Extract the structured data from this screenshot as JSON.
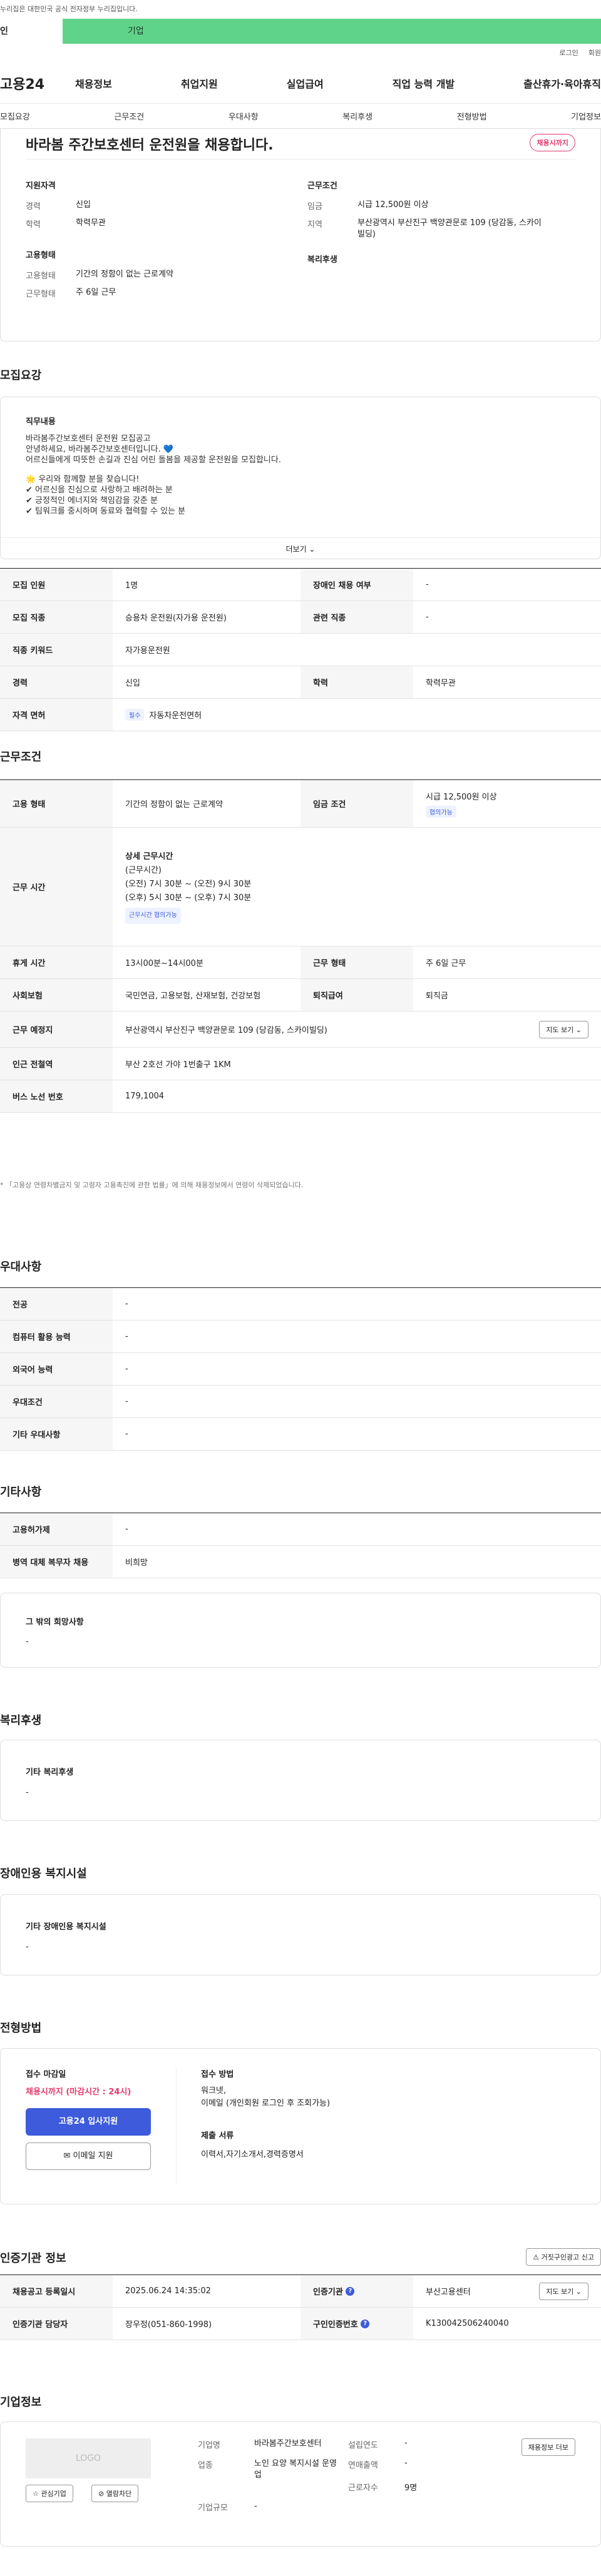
{
  "topbar": {
    "notice": "누리집은 대한민국 공식 전자정부 누리집입니다."
  },
  "tabs": {
    "person": "인",
    "business": "기업"
  },
  "utility": {
    "login": "로그인",
    "join": "회원"
  },
  "gnb": {
    "logo": "고용24",
    "menu": [
      "채용정보",
      "취업지원",
      "실업급여",
      "직업 능력 개발",
      "출산휴가·육아휴직"
    ]
  },
  "anchor": [
    "모집요강",
    "근무조건",
    "우대사항",
    "복리후생",
    "전형방법",
    "기업정보"
  ],
  "hero": {
    "title": "바라봄 주간보호센터 운전원을 채용합니다.",
    "status": "채용시까지",
    "qual_heading": "지원자격",
    "cond_heading": "근무조건",
    "emp_heading": "고용형태",
    "welfare_heading": "복리후생",
    "qual": [
      {
        "k": "경력",
        "v": "신입"
      },
      {
        "k": "학력",
        "v": "학력무관"
      }
    ],
    "cond": [
      {
        "k": "임금",
        "v": "시급 12,500원 이상"
      },
      {
        "k": "지역",
        "v": "부산광역시 부산진구 백양관문로 109 (당감동, 스카이빌딩)"
      }
    ],
    "emp": [
      {
        "k": "고용형태",
        "v": "기간의 정함이 없는 근로계약"
      },
      {
        "k": "근무형태",
        "v": "주 6일 근무"
      }
    ]
  },
  "recruit": {
    "title": "모집요강",
    "duty_label": "직무내용",
    "duty_lines": [
      "바라봄주간보호센터 운전원 모집공고",
      "안녕하세요, 바라봄주간보호센터입니다. 💙",
      "어르신들에게 따뜻한 손길과 진심 어린 돌봄을 제공할 운전원을 모집합니다.",
      "",
      "🌟 우리와 함께할 분을 찾습니다!",
      "✔ 어르신을 진심으로 사랑하고 배려하는 분",
      "✔ 긍정적인 에너지와 책임감을 갖춘 분",
      "✔ 팀워크를 중시하며 동료와 협력할 수 있는 분"
    ],
    "more": "더보기 ⌄",
    "rows": [
      {
        "k": "모집 인원",
        "v": "1명",
        "k2": "장애인 채용 여부",
        "v2": "-"
      },
      {
        "k": "모집 직종",
        "v": "승용차 운전원(자가용 운전원)",
        "k2": "관련 직종",
        "v2": "-"
      },
      {
        "k": "직종 키워드",
        "v": "자가용운전원"
      },
      {
        "k": "경력",
        "v": "신입",
        "k2": "학력",
        "v2": "학력무관"
      }
    ],
    "license_label": "자격 면허",
    "license_badge": "필수",
    "license": "자동차운전면허"
  },
  "conditions": {
    "title": "근무조건",
    "emp_k": "고용 형태",
    "emp_v": "기간의 정함이 없는 근로계약",
    "wage_k": "임금 조건",
    "wage_v": "시급 12,500원 이상",
    "wage_badge": "협의가능",
    "time_k": "근무 시간",
    "time_lines": [
      "상세 근무시간",
      "(근무시간)",
      "(오전) 7시 30분 ~ (오전) 9시 30분",
      "(오후) 5시 30분 ~ (오후) 7시 30분"
    ],
    "time_badge": "근무시간 협의가능",
    "break_k": "휴게 시간",
    "break_v": "13시00분~14시00분",
    "type_k": "근무 형태",
    "type_v": "주 6일 근무",
    "ins_k": "사회보험",
    "ins_v": "국민연금, 고용보험, 산재보험, 건강보험",
    "ret_k": "퇴직급여",
    "ret_v": "퇴직금",
    "place_k": "근무 예정지",
    "place_v": "부산광역시 부산진구 백양관문로 109 (당감동, 스카이빌딩)",
    "map_btn": "지도 보기 ⌄",
    "subway_k": "인근 전철역",
    "subway_v": "부산 2호선 가야 1번출구 1KM",
    "bus_k": "버스 노선 번호",
    "bus_v": "179,1004",
    "note": "* 「고용상 연령차별금지 및 고령자 고용촉진에 관한 법률」에 의해 채용정보에서 연령이 삭제되었습니다."
  },
  "prefer": {
    "title": "우대사항",
    "rows": [
      {
        "k": "전공",
        "v": "-"
      },
      {
        "k": "컴퓨터 활용 능력",
        "v": "-"
      },
      {
        "k": "외국어 능력",
        "v": "-"
      },
      {
        "k": "우대조건",
        "v": "-"
      },
      {
        "k": "기타 우대사항",
        "v": "-"
      }
    ]
  },
  "etc": {
    "title": "기타사항",
    "rows": [
      {
        "k": "고용허가제",
        "v": "-"
      },
      {
        "k": "병역 대체 복무자 채용",
        "v": "비희망"
      }
    ],
    "other_label": "그 밖의 희망사항",
    "other_v": "-"
  },
  "welfare": {
    "title": "복리후생",
    "label": "기타 복리후생",
    "v": "-"
  },
  "disab": {
    "title": "장애인용 복지시설",
    "label": "기타 장애인용 복지시설",
    "v": "-"
  },
  "process": {
    "title": "전형방법",
    "deadline_label": "접수 마감일",
    "deadline": "채용시까지 (마감시간 : 24시)",
    "apply": "고용24 입사지원",
    "email": "✉ 이메일 지원",
    "method_label": "접수 방법",
    "method_v": [
      "워크넷,",
      "이메일 (개인회원 로그인 후 조회가능)"
    ],
    "docs_label": "제출 서류",
    "docs_v": "이력서,자기소개서,경력증명서"
  },
  "cert": {
    "title": "인증기관 정보",
    "report": "⚠ 거짓구인광고 신고",
    "rows": [
      {
        "k": "채용공고 등록일시",
        "v": "2025.06.24 14:35:02",
        "k2": "인증기관",
        "v2": "부산고용센터",
        "btn": "지도 보기 ⌄"
      },
      {
        "k": "인증기관 담당자",
        "v": "장우정(051-860-1998)",
        "k2": "구인인증번호",
        "v2": "K130042506240040"
      }
    ]
  },
  "company": {
    "title": "기업정보",
    "logo": "LOGO",
    "interest": "☆ 관심기업",
    "block": "⊘ 열람차단",
    "all_jobs": "채용정보 더보",
    "rows": [
      {
        "k": "기업명",
        "v": "바라봄주간보호센터",
        "k2": "설립연도",
        "v2": "-"
      },
      {
        "k": "업종",
        "v": "노인 요양 복지시설 운영업",
        "k2": "연매출액",
        "v2": "-"
      },
      {
        "k": "",
        "v": "",
        "k2": "근로자수",
        "v2": "9명"
      },
      {
        "k": "기업규모",
        "v": "-"
      }
    ]
  }
}
